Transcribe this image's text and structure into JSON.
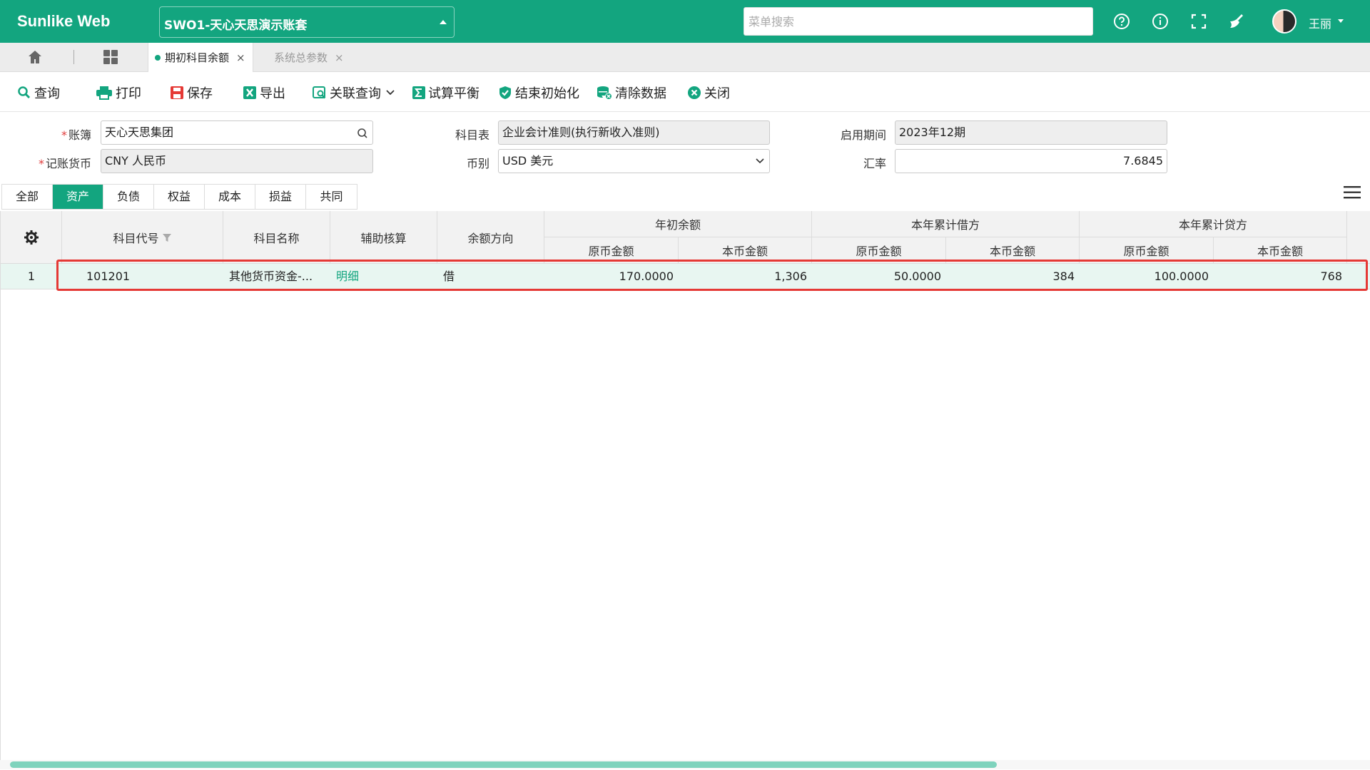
{
  "header": {
    "brand": "Sunlike Web",
    "account_set": "SWO1-天心天思演示账套",
    "menu_search_placeholder": "菜单搜索",
    "icons": [
      "help-icon",
      "info-icon",
      "fullscreen-icon",
      "clean-icon"
    ],
    "user": "王丽"
  },
  "tabs": {
    "active": "期初科目余额",
    "inactive": "系统总参数",
    "close": "×"
  },
  "toolbar": {
    "query": "查询",
    "print": "打印",
    "save": "保存",
    "export": "导出",
    "related_query": "关联查询",
    "trial_balance": "试算平衡",
    "finish_init": "结束初始化",
    "clear_data": "清除数据",
    "close": "关闭"
  },
  "form": {
    "ledger_label": "账簿",
    "ledger_value": "天心天思集团",
    "chart_label": "科目表",
    "chart_value": "企业会计准则(执行新收入准则)",
    "period_label": "启用期间",
    "period_value": "2023年12期",
    "currency_label": "记账货币",
    "currency_value": "CNY 人民币",
    "cur_type_label": "币别",
    "cur_type_value": "USD 美元",
    "rate_label": "汇率",
    "rate_value": "7.6845",
    "required_mark": "*"
  },
  "categories": [
    {
      "label": "全部",
      "active": false
    },
    {
      "label": "资产",
      "active": true
    },
    {
      "label": "负债",
      "active": false
    },
    {
      "label": "权益",
      "active": false
    },
    {
      "label": "成本",
      "active": false
    },
    {
      "label": "损益",
      "active": false
    },
    {
      "label": "共同",
      "active": false
    }
  ],
  "table": {
    "headers": {
      "code": "科目代号",
      "name": "科目名称",
      "aux": "辅助核算",
      "direction": "余额方向",
      "opening": "年初余额",
      "debit": "本年累计借方",
      "credit": "本年累计贷方",
      "orig": "原币金额",
      "local": "本币金额"
    },
    "rows": [
      {
        "no": "1",
        "code": "101201",
        "name": "其他货币资金-...",
        "aux": "明细",
        "direction": "借",
        "opening_orig": "170.0000",
        "opening_local": "1,306",
        "debit_orig": "50.0000",
        "debit_local": "384",
        "credit_orig": "100.0000",
        "credit_local": "768"
      }
    ]
  },
  "colors": {
    "brand": "#13a57f",
    "highlight": "#e53935"
  }
}
